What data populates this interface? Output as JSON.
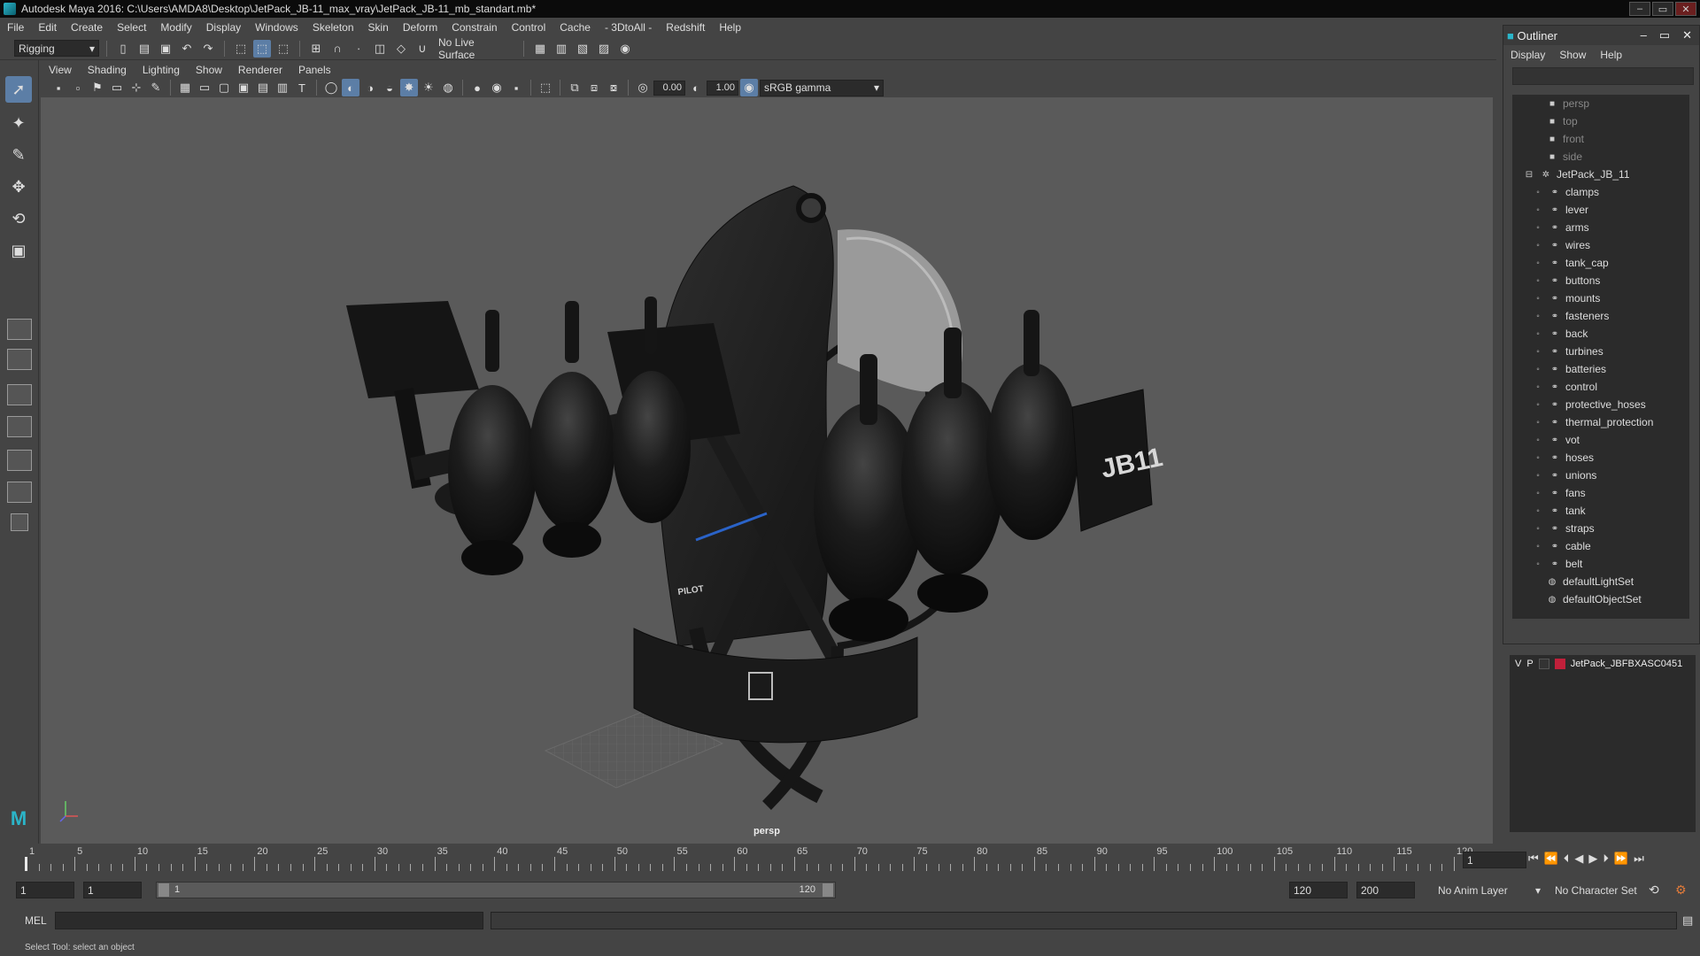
{
  "window": {
    "title": "Autodesk Maya 2016: C:\\Users\\AMDA8\\Desktop\\JetPack_JB-11_max_vray\\JetPack_JB-11_mb_standart.mb*"
  },
  "menubar": {
    "items": [
      "File",
      "Edit",
      "Create",
      "Select",
      "Modify",
      "Display",
      "Windows",
      "Skeleton",
      "Skin",
      "Deform",
      "Constrain",
      "Control",
      "Cache",
      "- 3DtoAll -",
      "Redshift",
      "Help"
    ]
  },
  "statusline": {
    "mode": "Rigging",
    "live_surface": "No Live Surface"
  },
  "panel": {
    "menu": [
      "View",
      "Shading",
      "Lighting",
      "Show",
      "Renderer",
      "Panels"
    ],
    "near_value": "0.00",
    "far_value": "1.00",
    "color_space": "sRGB gamma",
    "camera_label": "persp"
  },
  "outliner": {
    "title": "Outliner",
    "menu": [
      "Display",
      "Show",
      "Help"
    ],
    "cameras": [
      "persp",
      "top",
      "front",
      "side"
    ],
    "root": "JetPack_JB_11",
    "children": [
      "clamps",
      "lever",
      "arms",
      "wires",
      "tank_cap",
      "buttons",
      "mounts",
      "fasteners",
      "back",
      "turbines",
      "batteries",
      "control",
      "protective_hoses",
      "thermal_protection",
      "vot",
      "hoses",
      "unions",
      "fans",
      "tank",
      "straps",
      "cable",
      "belt"
    ],
    "sets": [
      "defaultLightSet",
      "defaultObjectSet"
    ]
  },
  "layers": {
    "v": "V",
    "p": "P",
    "name": "JetPack_JBFBXASC0451",
    "color": "#c0203a"
  },
  "timeline": {
    "ticks": [
      "1",
      "5",
      "10",
      "15",
      "20",
      "25",
      "30",
      "35",
      "40",
      "45",
      "50",
      "55",
      "60",
      "65",
      "70",
      "75",
      "80",
      "85",
      "90",
      "95",
      "100",
      "105",
      "110",
      "115",
      "120"
    ],
    "current_frame": "1"
  },
  "range": {
    "start": "1",
    "playback_start": "1",
    "slider_start": "1",
    "slider_end": "120",
    "playback_end": "120",
    "end": "200",
    "anim_layer": "No Anim Layer",
    "character_set": "No Character Set"
  },
  "command": {
    "lang": "MEL"
  },
  "help": {
    "text": "Select Tool: select an object"
  },
  "model": {
    "label_pilot": "PILOT",
    "label_jb": "JB11"
  }
}
